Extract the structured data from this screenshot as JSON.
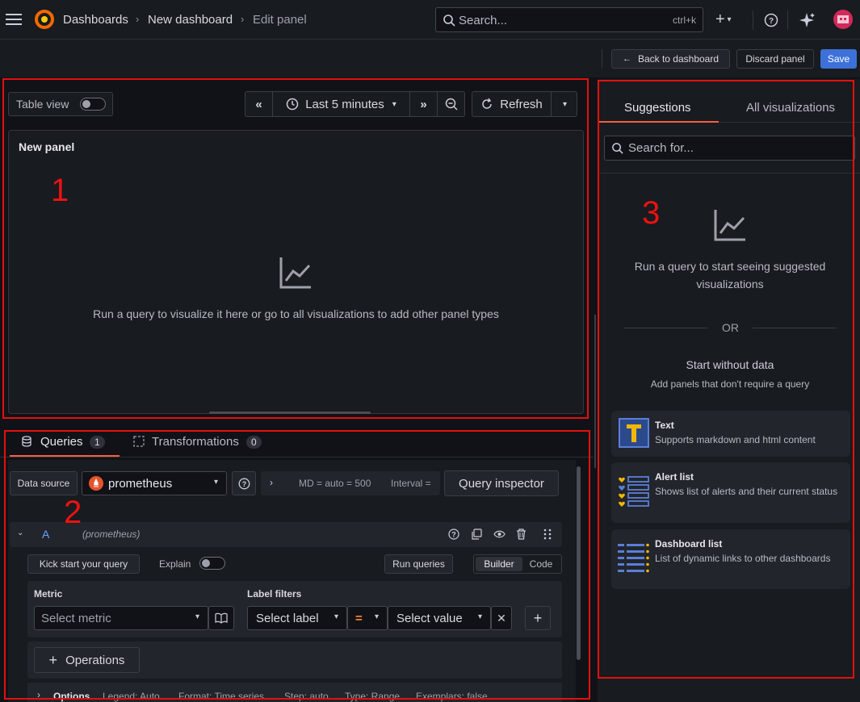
{
  "header": {
    "breadcrumbs": [
      "Dashboards",
      "New dashboard",
      "Edit panel"
    ],
    "search_placeholder": "Search...",
    "search_shortcut": "ctrl+k",
    "plus_icon_label": "+"
  },
  "toolbar": {
    "back_label": "Back to dashboard",
    "discard_label": "Discard panel",
    "save_label": "Save"
  },
  "preview": {
    "table_view_label": "Table view",
    "time_range_label": "Last 5 minutes",
    "refresh_label": "Refresh",
    "panel_title": "New panel",
    "empty_message": "Run a query to visualize it here or go to all visualizations to add other panel types"
  },
  "annotations": [
    "1",
    "2",
    "3"
  ],
  "query_tabs": [
    {
      "label": "Queries",
      "count": "1"
    },
    {
      "label": "Transformations",
      "count": "0"
    }
  ],
  "query_editor": {
    "datasource_label": "Data source",
    "datasource_value": "prometheus",
    "md_text": "MD = auto = 500",
    "interval_text": "Interval =",
    "inspector_label": "Query inspector",
    "query_letter": "A",
    "query_source": "(prometheus)",
    "kickstart_label": "Kick start your query",
    "explain_label": "Explain",
    "run_label": "Run queries",
    "builder_label": "Builder",
    "code_label": "Code",
    "metric_label": "Metric",
    "metric_placeholder": "Select metric",
    "label_filters_label": "Label filters",
    "select_label_placeholder": "Select label",
    "operator_value": "=",
    "select_value_placeholder": "Select value",
    "operations_label": "Operations",
    "options_label": "Options",
    "options_summary": [
      "Legend: Auto",
      "Format: Time series",
      "Step: auto",
      "Type: Range",
      "Exemplars: false"
    ]
  },
  "viz_picker": {
    "tabs": [
      "Suggestions",
      "All visualizations"
    ],
    "search_placeholder": "Search for...",
    "empty_line1": "Run a query to start seeing suggested",
    "empty_line2": "visualizations",
    "or_label": "OR",
    "start_without_data": "Start without data",
    "start_without_data_sub": "Add panels that don't require a query",
    "cards": [
      {
        "title": "Text",
        "desc": "Supports markdown and html content"
      },
      {
        "title": "Alert list",
        "desc": "Shows list of alerts and their current status"
      },
      {
        "title": "Dashboard list",
        "desc": "List of dynamic links to other dashboards"
      }
    ]
  },
  "colors": {
    "accent_blue": "#3d71d9",
    "annotation_red": "#e3110e",
    "tab_underline": "#f55f3e"
  }
}
